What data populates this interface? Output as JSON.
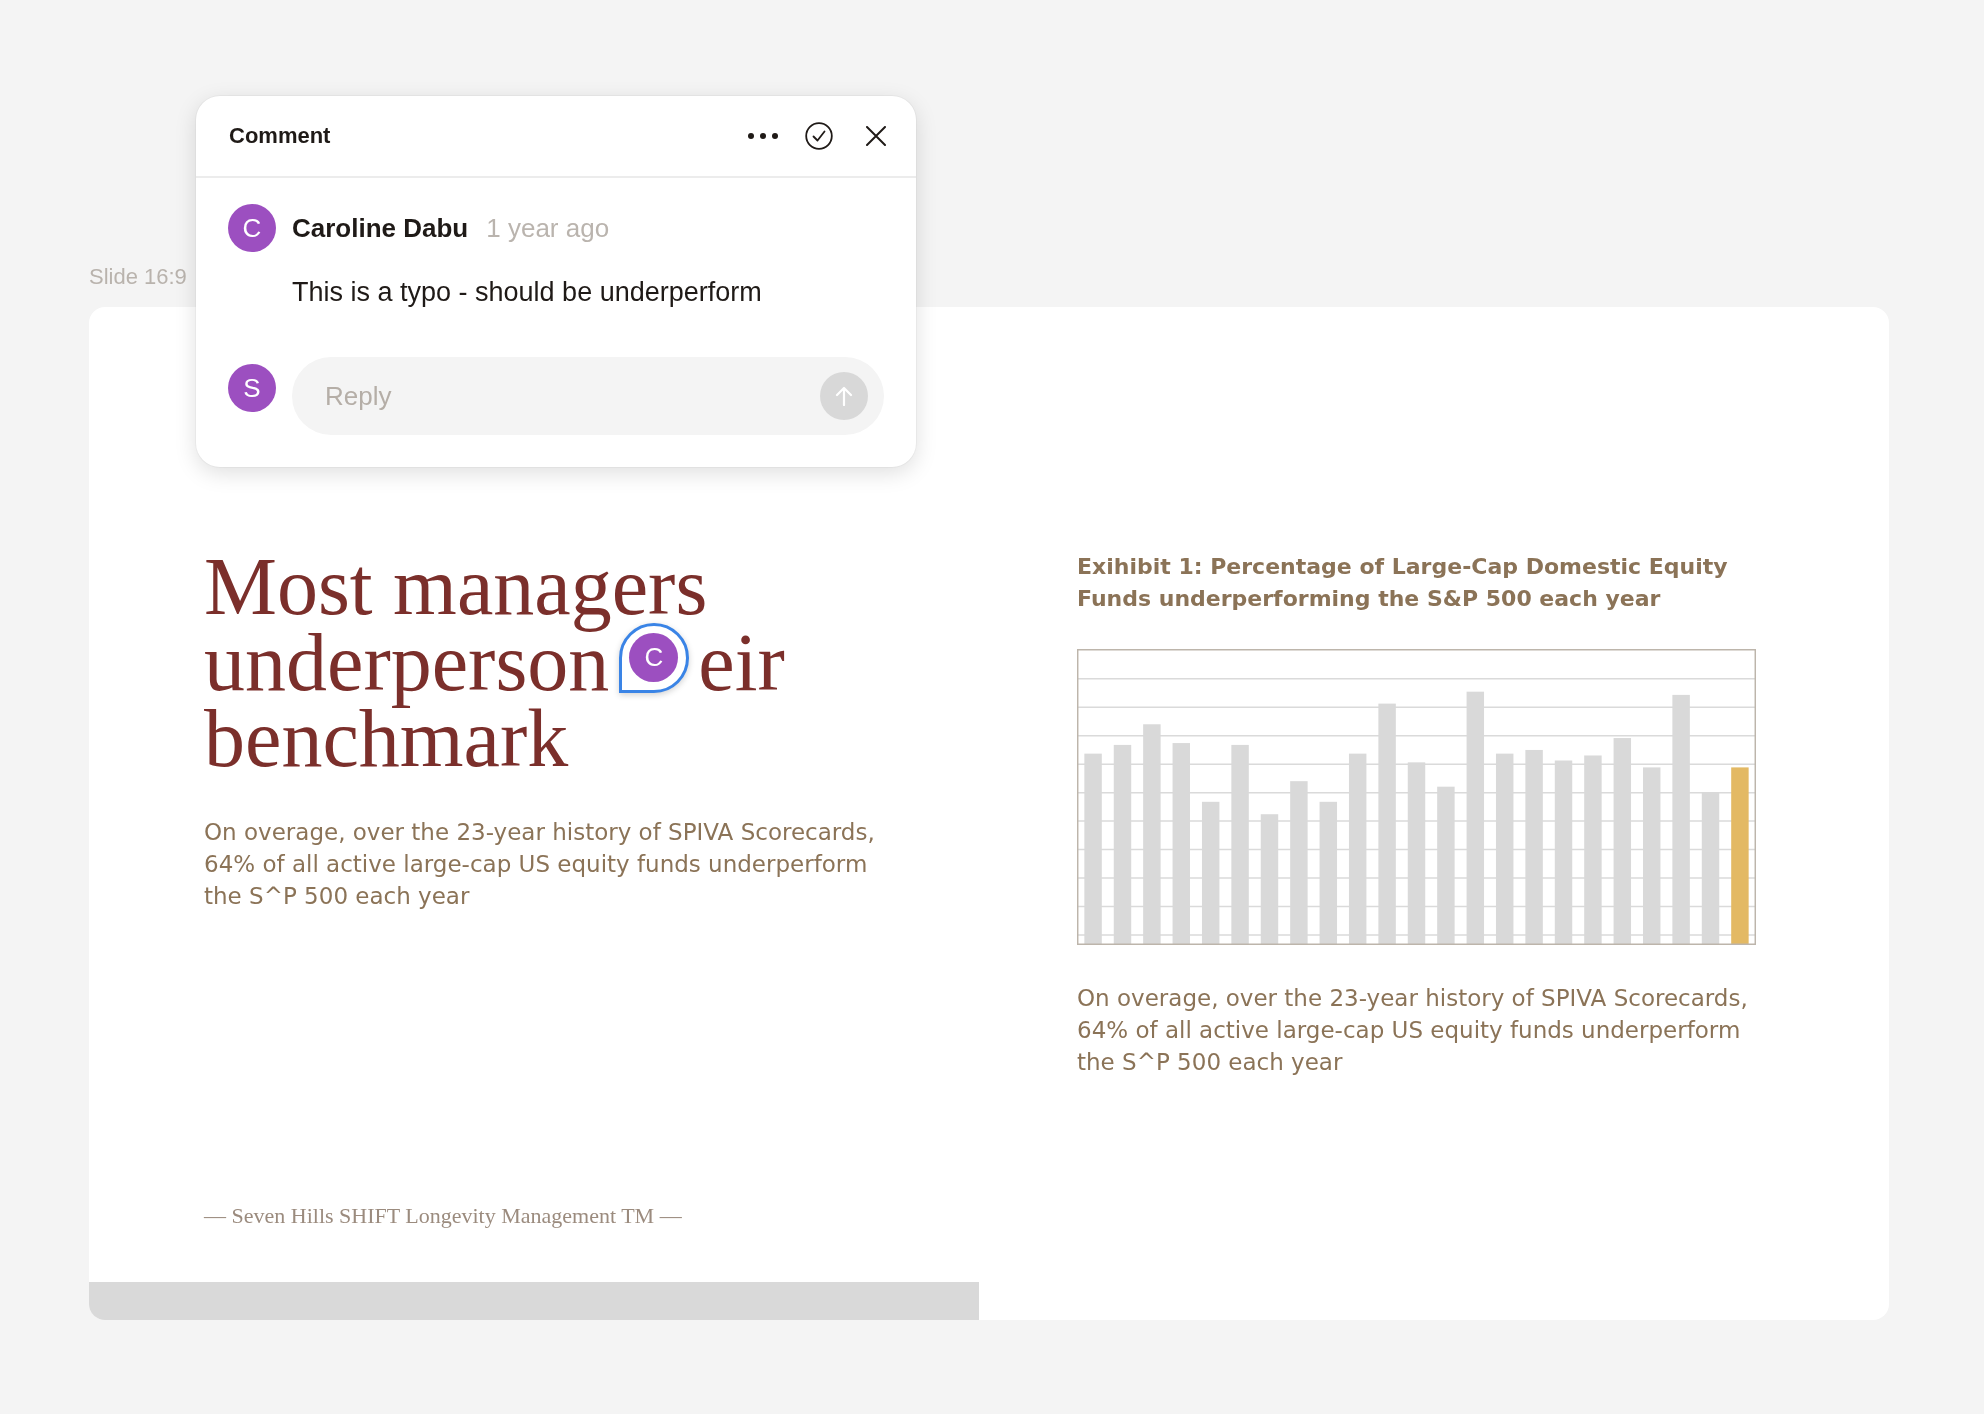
{
  "comment_popup": {
    "title": "Comment",
    "comment": {
      "author_initial": "C",
      "author": "Caroline Dabu",
      "time": "1 year ago",
      "text": "This is a typo - should be underperform"
    },
    "reply": {
      "user_initial": "S",
      "placeholder": "Reply",
      "send_disabled": true
    }
  },
  "slide_label": "Slide 16:9",
  "slide": {
    "title": {
      "line_1": "Most managers",
      "line_2_start": "underperson",
      "line_2_end": "eir",
      "line_3": "benchmark"
    },
    "comment_pin": {
      "initial": "C"
    },
    "paragraph": "On overage, over the 23-year history of SPIVA Scorecards, 64% of all active large-cap US equity funds underperform the S^P 500 each year",
    "exhibit": {
      "title": "Exihibit 1: Percentage of Large-Cap Domestic Equity Funds underperforming the S&P 500 each year",
      "caption": "On overage, over the 23-year history of SPIVA Scorecards, 64% of all active large-cap US equity funds underperform the S^P 500 each year"
    },
    "footer": "— Seven Hills SHIFT Longevity Management TM —"
  }
}
